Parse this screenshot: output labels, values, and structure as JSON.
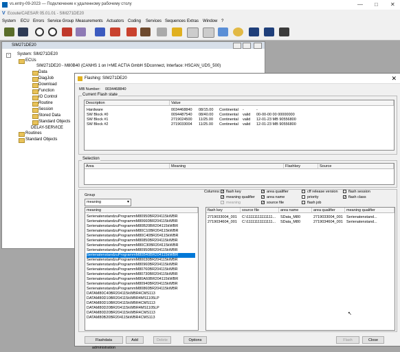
{
  "rdp": {
    "title": "vs.entry-09-2023 — Подключение к удаленному рабочему столу",
    "controls": [
      "—",
      "□",
      "✕"
    ]
  },
  "app": {
    "title": "Ecoute/CAESAR 05.01.01 - SIM271DE20",
    "menu": [
      "System",
      "ECU",
      "Errors",
      "Service Group",
      "Measurements",
      "Actuators",
      "Coding",
      "Services",
      "Sequences",
      "Extras",
      "Window",
      "?"
    ]
  },
  "toolbar_icons": [
    "car-icon",
    "close-session-icon",
    "compass-icon",
    "stopwatch-icon",
    "ecu-icon",
    "measure-icon",
    "car-blue-icon",
    "gauge-icon",
    "eye-icon",
    "flash-icon",
    "list-icon",
    "grid-icon",
    "sequence-icon",
    "magnifier-icon",
    "binoculars-icon",
    "binoculars2-icon",
    "tree-icon"
  ],
  "tree": {
    "window_title": "SIM271DE20",
    "items": [
      {
        "label": "System: SIM271DE20"
      },
      {
        "label": "ECUs"
      },
      {
        "label": "SIM271DE20 - M80B40 (CANHS 1 on I+ME ACTIA GmbH SDconnect, Interface: HSCAN_UDS_500)"
      },
      {
        "label": "Data"
      },
      {
        "label": "DiagJob"
      },
      {
        "label": "Download"
      },
      {
        "label": "Function"
      },
      {
        "label": "IO Control"
      },
      {
        "label": "Routine"
      },
      {
        "label": "Session"
      },
      {
        "label": "Stored Data"
      },
      {
        "label": "Standard Objects"
      },
      {
        "label": "DELAY-SERVICE"
      },
      {
        "label": "Routines"
      },
      {
        "label": "Standard Objects"
      }
    ]
  },
  "dialog": {
    "title": "Flashing: SIM271DE20",
    "mb_number_label": "MB Number:",
    "mb_number_value": "0034468840",
    "current_state_label": "Current Flash state",
    "state_headers": [
      "Description",
      "Value"
    ],
    "state_rows": [
      [
        "Hardware",
        "0034468840",
        "08/15.00",
        "Continental",
        "-",
        "-"
      ],
      [
        "SW Block #0",
        "0094487540",
        "08/40.00",
        "Continental",
        "valid",
        "00-00-00  00 00000000"
      ],
      [
        "SW Block #1",
        "2719024500",
        "11/25.00",
        "Continental",
        "valid",
        "12-01-23  MB 90556800"
      ],
      [
        "SW Block #2",
        "2719033004",
        "11/25.00",
        "Continental",
        "valid",
        "12-01-23  MB 90556800"
      ]
    ],
    "selection_label": "Selection",
    "selection_headers": [
      "Area",
      "Meaning",
      "Flashkey",
      "Source"
    ],
    "group_label": "Group",
    "group_value": "meaning",
    "columns_label": "Columns:",
    "columns": [
      {
        "label": "flash key",
        "checked": true,
        "enabled": true
      },
      {
        "label": "meaning qualifier",
        "checked": true,
        "enabled": true
      },
      {
        "label": "meaning",
        "checked": true,
        "enabled": false
      },
      {
        "label": "area qualifier",
        "checked": true,
        "enabled": true
      },
      {
        "label": "area name",
        "checked": true,
        "enabled": true
      },
      {
        "label": "source file",
        "checked": true,
        "enabled": true
      },
      {
        "label": "cff release version",
        "checked": false,
        "enabled": true
      },
      {
        "label": "priority",
        "checked": false,
        "enabled": true
      },
      {
        "label": "flash job",
        "checked": false,
        "enabled": true
      },
      {
        "label": "flash session",
        "checked": false,
        "enabled": true
      },
      {
        "label": "flash class",
        "checked": true,
        "enabled": true
      }
    ],
    "meaning_header": "meaning",
    "meaning_items": [
      "SerienatenstandzuProgrammM80950BR204115kWBR",
      "SerienatenstandzuProgrammM80660BR204115kWBR",
      "SerienatenstandzuProgrammM80B20BR204115kWBR",
      "SerienatenstandzuProgrammM80C10BR204115kWBR",
      "SerienatenstandzuProgrammM80C40BR204115kWBR",
      "SerienatenstandzuProgrammM80850BR204115kWBR",
      "SerienatenstandzuProgrammM80C30BR204115kWBR",
      "SerienatenstandzuProgrammM80950BR204115kWBR",
      "SerienatenstandzuProgrammM80B40BR204115kWBR",
      "SerienatenstandzuProgrammM80030BR204115kWBR",
      "SerienatenstandzuProgrammM80960BR204115kWBR",
      "SerienatenstandzuProgrammM80760BR204115kWBR",
      "SerienatenstandzuProgrammM80730BR204115kWBR",
      "SerienatenstandzuProgrammM80A60BR204115kWBR",
      "SerienatenstandzuProgrammM80940BR204115kWBR",
      "SerienatenstandzuProgrammM80860BR204115kWBR",
      "DATAM80C40BR204115kWBR4CMS113",
      "DATAM80D10BR204115kWBR4MS1105LP",
      "DATAM80D10BR204115kWBR4CMS113",
      "DATAM80D20BR204115kWBR4MS1105LP",
      "DATAM80D20BR204115kWBR4CMS113",
      "DATAM80B20BR204115kWBR4CMS113"
    ],
    "selected_index": 8,
    "detail_headers": [
      "flash key",
      "source file",
      "area name",
      "area qualifier",
      "meaning qualifier"
    ],
    "detail_rows": [
      [
        "2719033004_001",
        "C:\\11111111111111...",
        "SData_M80",
        "2719033004_001",
        "Serienatenstand..."
      ],
      [
        "2719034604_001",
        "C:\\11111111111111...",
        "SData_M80",
        "2719034604_001",
        "Serienatenstand..."
      ]
    ],
    "buttons": {
      "admin": "Flashdata administration",
      "add": "Add",
      "delete": "Delete",
      "options": "Options",
      "flash": "Flash",
      "close": "Close"
    }
  }
}
